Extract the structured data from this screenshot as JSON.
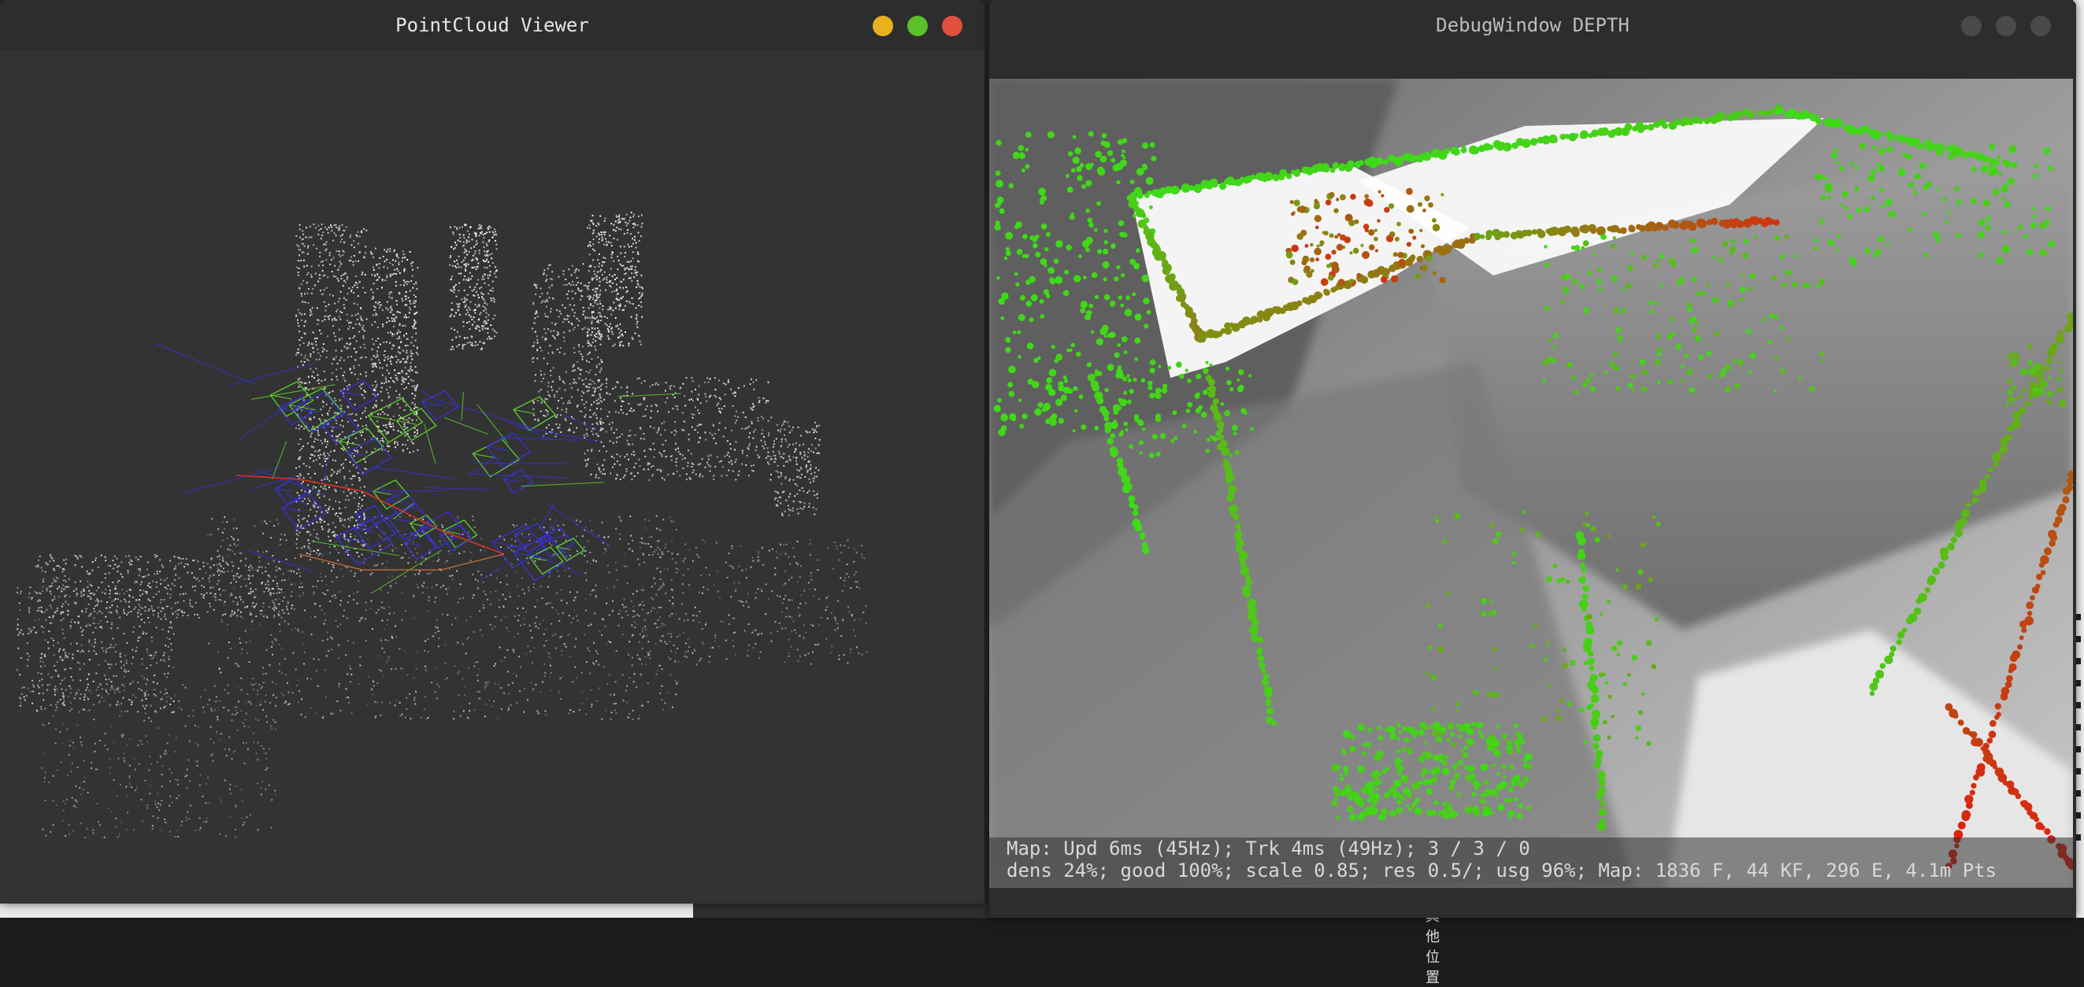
{
  "windows": {
    "pointcloud": {
      "title": "PointCloud Viewer",
      "buttons": {
        "minimize_color": "#e8b21f",
        "maximize_color": "#5cbf2c",
        "close_color": "#e0503d"
      }
    },
    "debug": {
      "title": "DebugWindow DEPTH",
      "buttons": {
        "minimize_color": "#4a4a4a",
        "maximize_color": "#4a4a4a",
        "close_color": "#4a4a4a"
      },
      "status_lines": [
        "Map: Upd   6ms (45Hz); Trk   4ms (49Hz); 3 / 3 / 0",
        "dens 24%; good 100%; scale 0.85; res 0.5/; usg 96%; Map: 1836 F, 44 KF, 296 E, 4.1m Pts"
      ]
    }
  },
  "background": {
    "partial_text": "其他位置"
  },
  "colors": {
    "desktop": "#2b2b2b",
    "titlebar": "#2d2d2d",
    "keyframe_blue": "#3a2fe0",
    "keyframe_green": "#5fd22c",
    "trajectory_red": "#e03020",
    "depth_near": "#e02010",
    "depth_far": "#3cdc18"
  }
}
